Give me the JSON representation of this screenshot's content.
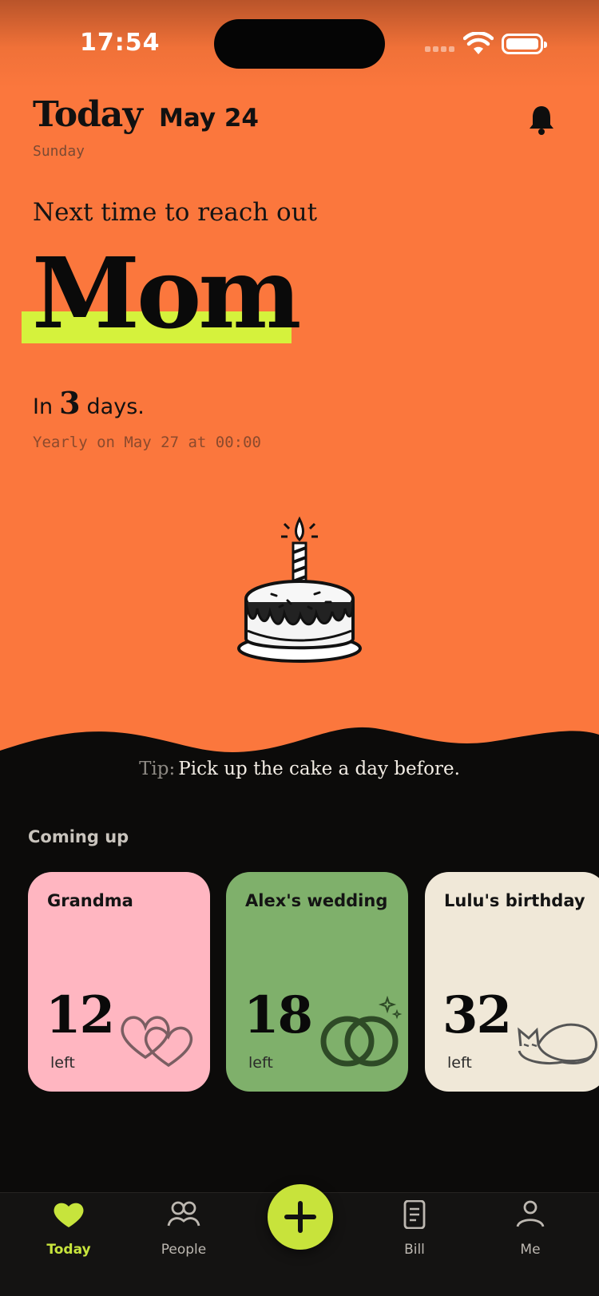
{
  "status_bar": {
    "time": "17:54"
  },
  "header": {
    "title": "Today",
    "date": "May 24",
    "weekday": "Sunday"
  },
  "next": {
    "heading": "Next time to reach out",
    "name": "Mom",
    "countdown_prefix": "In",
    "countdown_value": "3",
    "countdown_suffix": "days.",
    "schedule": "Yearly on May 27 at 00:00"
  },
  "tip": {
    "label": "Tip:",
    "text": "Pick up the cake a day before."
  },
  "coming_up": {
    "title": "Coming up",
    "cards": [
      {
        "name": "Grandma",
        "days": "12",
        "left_label": "left",
        "color": "#ffb6c1",
        "icon": "hearts-icon"
      },
      {
        "name": "Alex's wedding",
        "days": "18",
        "left_label": "left",
        "color": "#7fb06b",
        "icon": "rings-icon"
      },
      {
        "name": "Lulu's birthday",
        "days": "32",
        "left_label": "left",
        "color": "#f0e8d8",
        "icon": "cat-icon"
      }
    ]
  },
  "tabbar": {
    "tabs": [
      {
        "label": "Today",
        "icon": "heart-icon",
        "active": true
      },
      {
        "label": "People",
        "icon": "people-icon",
        "active": false
      },
      {
        "label": "Bill",
        "icon": "document-icon",
        "active": false
      },
      {
        "label": "Me",
        "icon": "person-icon",
        "active": false
      }
    ],
    "add_icon": "plus-icon"
  },
  "colors": {
    "accent": "#c8e33b",
    "background_top": "#fb773d",
    "background_bottom": "#0c0b0a",
    "highlight": "#d5f23c"
  }
}
